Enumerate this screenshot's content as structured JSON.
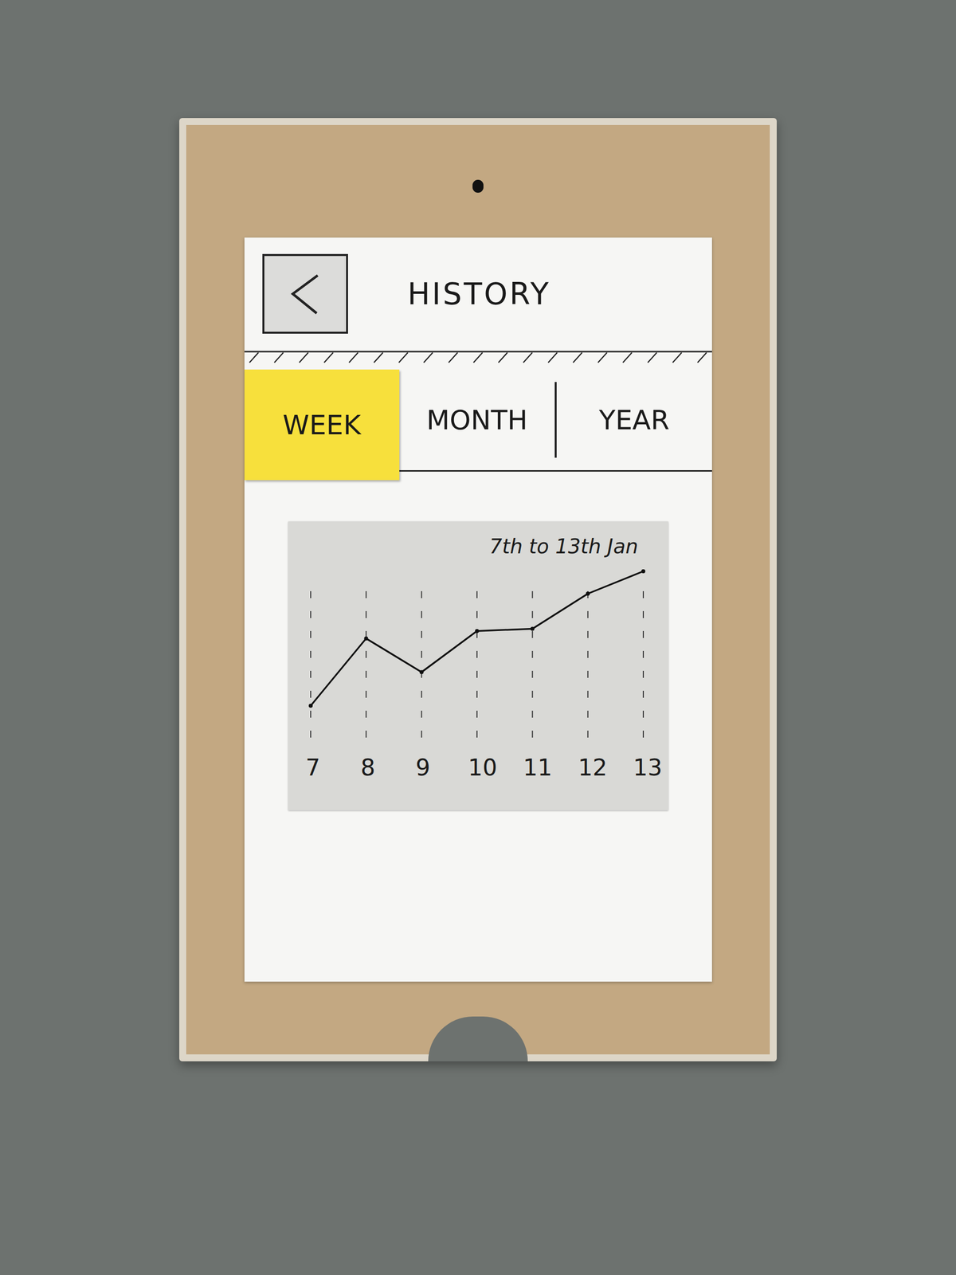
{
  "screen": {
    "title": "HISTORY"
  },
  "tabs": [
    {
      "label": "WEEK",
      "selected": true
    },
    {
      "label": "MONTH",
      "selected": false
    },
    {
      "label": "YEAR",
      "selected": false
    }
  ],
  "chart": {
    "title": "7th to 13th Jan",
    "x_ticks": [
      "7",
      "8",
      "9",
      "10",
      "11",
      "12",
      "13"
    ],
    "series": [
      {
        "values": [
          4,
          13,
          8.5,
          14,
          14.3,
          19,
          22
        ]
      }
    ]
  }
}
